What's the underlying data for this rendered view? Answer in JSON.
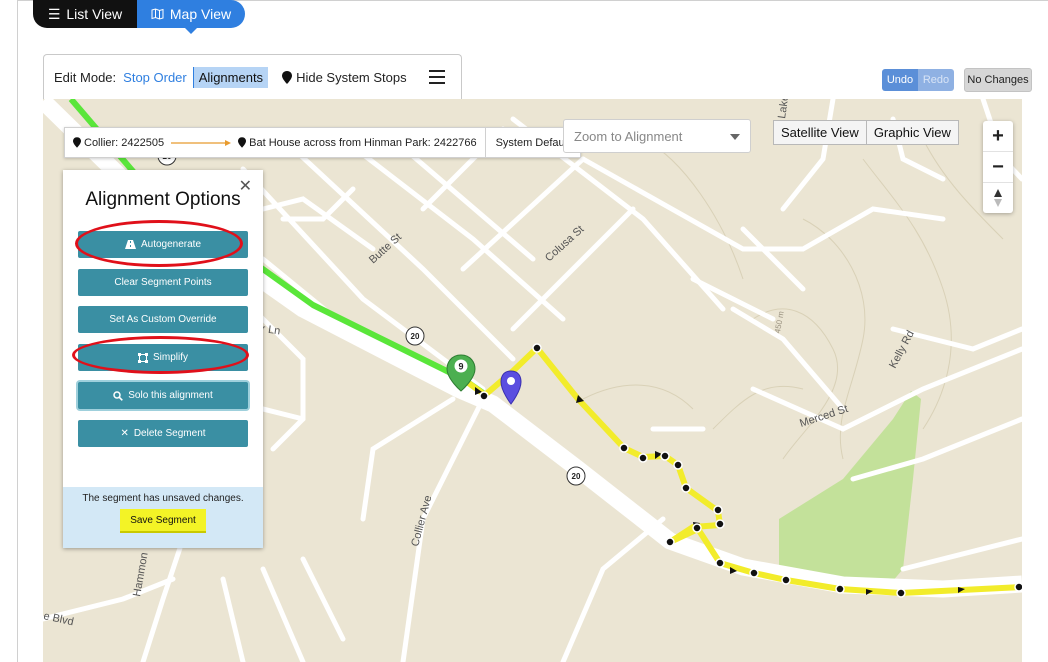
{
  "view_toggle": {
    "list_label": "List View",
    "map_label": "Map View"
  },
  "edit_bar": {
    "mode_label": "Edit Mode:",
    "stop_order": "Stop Order",
    "alignments": "Alignments",
    "hide_system_stops": "Hide System Stops"
  },
  "history": {
    "undo": "Undo",
    "redo": "Redo",
    "status": "No Changes"
  },
  "route": {
    "from": "Collier: 2422505",
    "to": "Bat House across from Hinman Park: 2422766",
    "default_label": "System Default"
  },
  "zoom_select": {
    "placeholder": "Zoom to Alignment"
  },
  "map_type": {
    "satellite": "Satellite View",
    "graphic": "Graphic View"
  },
  "zoom": {
    "plus": "+",
    "minus": "−"
  },
  "panel": {
    "title": "Alignment Options",
    "close": "✕",
    "buttons": {
      "autogenerate": "Autogenerate",
      "clear": "Clear Segment Points",
      "custom_override": "Set As Custom Override",
      "simplify": "Simplify",
      "solo": "Solo this alignment",
      "delete": "Delete Segment"
    },
    "unsaved_message": "The segment has unsaved changes.",
    "save": "Save Segment"
  },
  "map_labels": {
    "butte": "Butte St",
    "colusa": "Colusa St",
    "ln": "er Ln",
    "collier": "Collier Ave",
    "merced": "Merced St",
    "kelly": "Kelly Rd",
    "hammon": "Hammon",
    "blvd": "e Blvd",
    "lake": "Lake",
    "route_20a": "20",
    "route_20b": "20",
    "route_20c": "20",
    "elev": "450 m",
    "stop_number": "9"
  },
  "colors": {
    "accent": "#2f7fe0",
    "panel_button": "#3a8fa3",
    "route_green": "#5ae63a",
    "route_yellow": "#f2ec2b",
    "highlight_red": "#e0101a"
  }
}
